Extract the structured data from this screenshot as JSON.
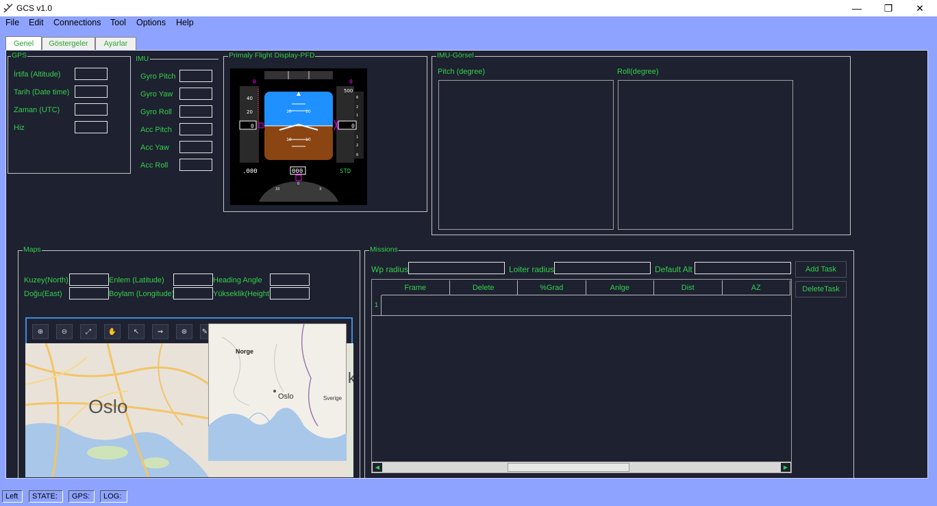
{
  "window": {
    "title": "GCS v1.0",
    "minimize": "—",
    "restore": "❐",
    "close": "✕"
  },
  "menu": [
    "File",
    "Edit",
    "Connections",
    "Tool",
    "Options",
    "Help"
  ],
  "tabs": [
    "Genel",
    "Göstergeler",
    "Ayarlar"
  ],
  "gps": {
    "title": "GPS",
    "labels": [
      "İrtifa (Altitude)",
      "Tarih (Date time)",
      "Zaman (UTC)",
      "Hiz"
    ]
  },
  "imu": {
    "title": "IMU",
    "labels": [
      "Gyro Pitch",
      "Gyro Yaw",
      "Gyro Roll",
      "Acc Pitch",
      "Acc Yaw",
      "Acc Roll"
    ]
  },
  "pfd": {
    "title": "Primaly Flight Display-PFD",
    "speed_value": "0",
    "speed_ticks": [
      "40",
      "20"
    ],
    "alt_value": "0",
    "alt_tick": "500",
    "speed_top": "0",
    "alt_top": "0",
    "pitch_marks": [
      "10",
      "10",
      "10",
      "10"
    ],
    "mach": ".000",
    "heading": "000",
    "baro": "STD",
    "heading_ticks": [
      "33",
      "0",
      "3"
    ],
    "vsi_ticks": [
      "6",
      "2",
      "1",
      "1",
      "2",
      "6"
    ]
  },
  "imu_visual": {
    "title": "IMU-Görsel",
    "pitch_label": "Pitch (degree)",
    "roll_label": "Roll(degree)"
  },
  "maps": {
    "title": "Maps",
    "labels": [
      "Kuzey(North)",
      "Doğu(East)",
      "Enlem (Latitude)",
      "Boylam (Longitude)",
      "Heading Angle",
      "Yükseklik(Height)"
    ],
    "main_city": "Oslo",
    "overview_labels": [
      "Norge",
      "Oslo",
      "Sverige"
    ],
    "edge_letter": "k",
    "tools": [
      "⊕",
      "⊖",
      "⤢",
      "✋",
      "↖",
      "⇝",
      "⊛",
      "✎"
    ]
  },
  "missions": {
    "title": "Missions",
    "wp_radius": "Wp radius",
    "loiter_radius": "Loiter radius",
    "default_alt": "Default Alt",
    "add_task": "Add Task",
    "delete_task": "DeleteTask",
    "columns": [
      "Frame",
      "Delete",
      "%Grad",
      "Anlge",
      "Dist",
      "AZ"
    ],
    "row_numbers": [
      "1"
    ]
  },
  "status": [
    "Left",
    "STATE:",
    "GPS:",
    "LOG:"
  ],
  "colors": {
    "accent": "#33d14b",
    "panel_bg": "#1e2130",
    "window_bg": "#8ea3ff",
    "sky": "#1e90ff",
    "ground": "#8b4513",
    "pfd_magenta": "#ff00ff"
  }
}
